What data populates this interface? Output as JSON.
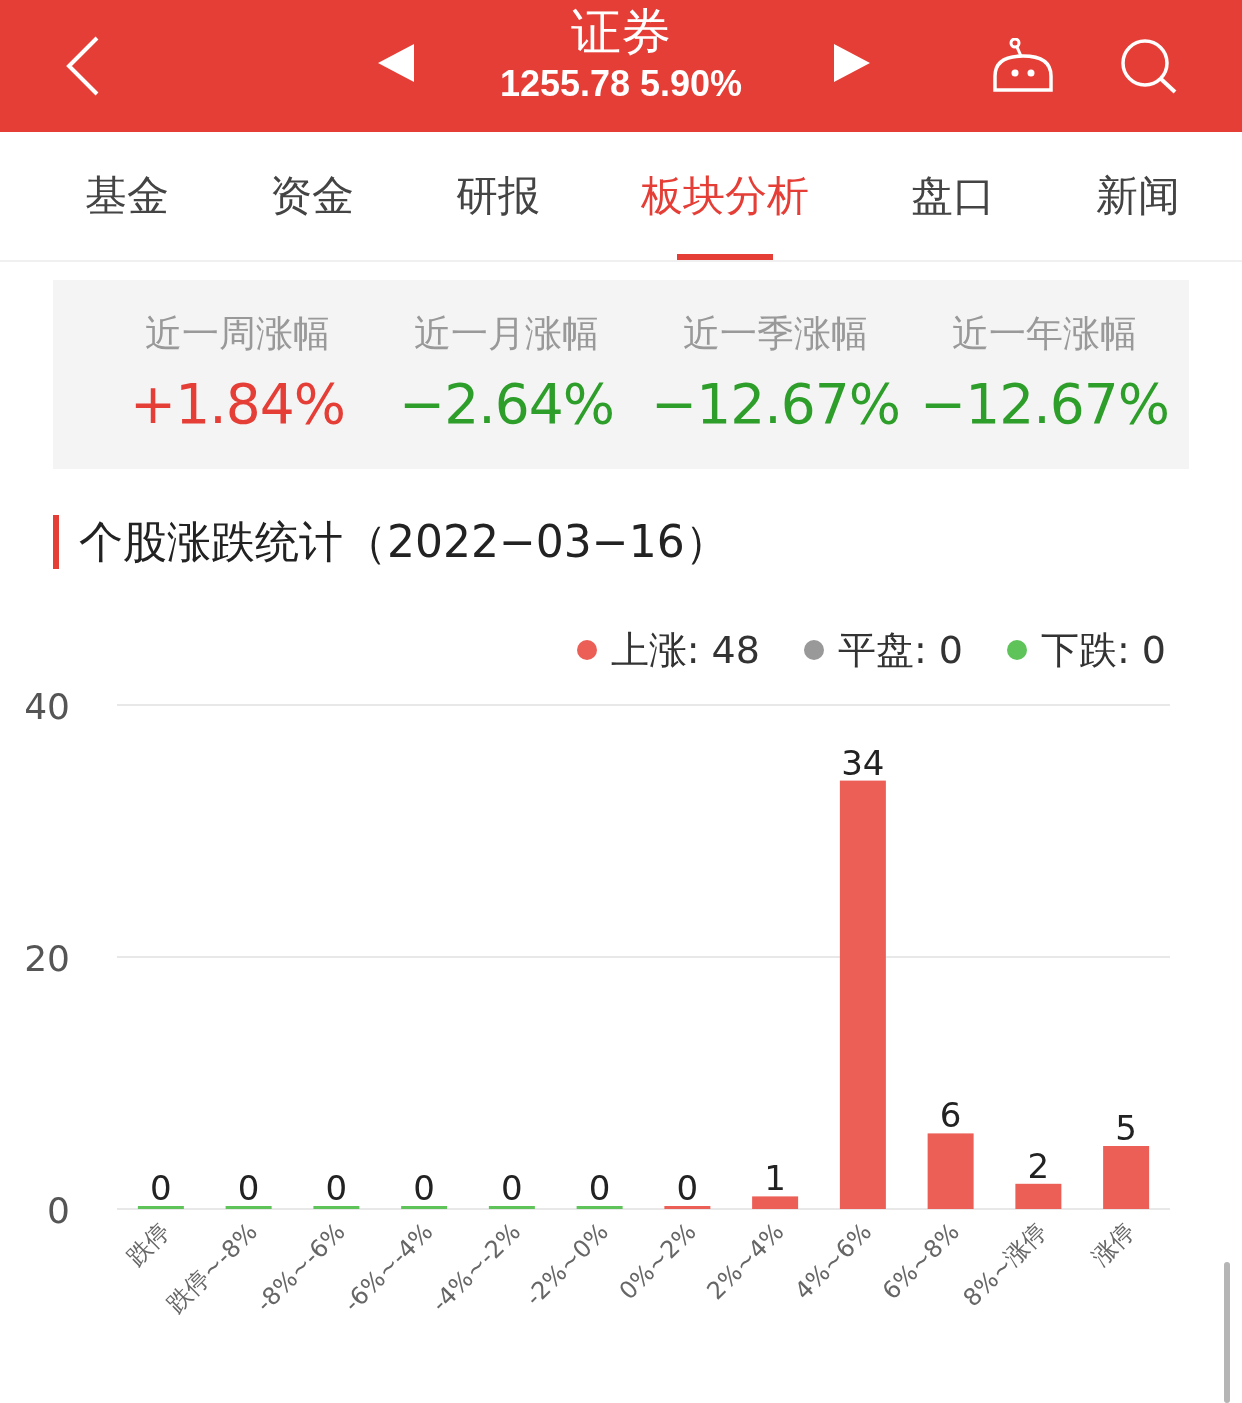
{
  "header": {
    "title": "证券",
    "quote": "1255.78 5.90%"
  },
  "tabs": [
    {
      "label": "基金",
      "selected": false
    },
    {
      "label": "资金",
      "selected": false
    },
    {
      "label": "研报",
      "selected": false
    },
    {
      "label": "板块分析",
      "selected": true
    },
    {
      "label": "盘口",
      "selected": false
    },
    {
      "label": "新闻",
      "selected": false
    }
  ],
  "periods": [
    {
      "label": "近一周涨幅",
      "value": "+1.84%",
      "color": "#e53e36"
    },
    {
      "label": "近一月涨幅",
      "value": "−2.64%",
      "color": "#2e9e2a"
    },
    {
      "label": "近一季涨幅",
      "value": "−12.67%",
      "color": "#2e9e2a"
    },
    {
      "label": "近一年涨幅",
      "value": "−12.67%",
      "color": "#2e9e2a"
    }
  ],
  "section_title": "个股涨跌统计（2022−03−16）",
  "legend": [
    {
      "label": "上涨: 48",
      "color": "#ec5f57"
    },
    {
      "label": "平盘: 0",
      "color": "#999999"
    },
    {
      "label": "下跌: 0",
      "color": "#5ec45a"
    }
  ],
  "chart_data": {
    "type": "bar",
    "categories": [
      "跌停",
      "跌停~-8%",
      "-8%~-6%",
      "-6%~-4%",
      "-4%~-2%",
      "-2%~0%",
      "0%~2%",
      "2%~4%",
      "4%~6%",
      "6%~8%",
      "8%~涨停",
      "涨停"
    ],
    "series": [
      {
        "color": "#5ec45a",
        "values": [
          0,
          0,
          0,
          0,
          0,
          0,
          null,
          null,
          null,
          null,
          null,
          null
        ]
      },
      {
        "color": "#ec5f57",
        "values": [
          null,
          null,
          null,
          null,
          null,
          null,
          0,
          1,
          34,
          6,
          2,
          5
        ]
      }
    ],
    "ylim": [
      0,
      40
    ],
    "yticks": [
      0,
      20,
      40
    ],
    "stacked": true,
    "data_labels": true
  }
}
